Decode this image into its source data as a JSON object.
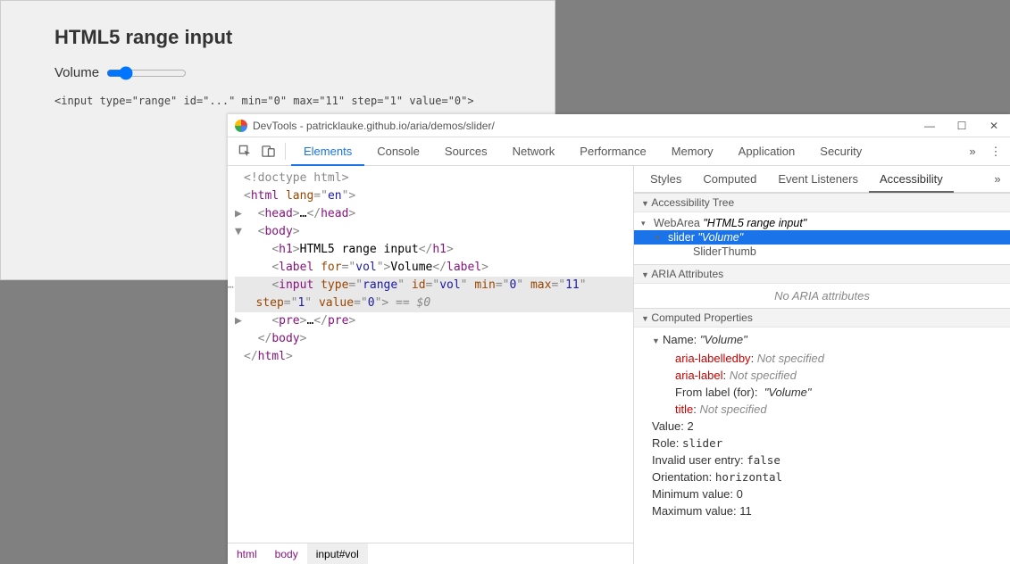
{
  "page": {
    "heading": "HTML5 range input",
    "label": "Volume",
    "code": "<input type=\"range\" id=\"...\" min=\"0\" max=\"11\" step=\"1\" value=\"0\">",
    "sliderMin": "0",
    "sliderMax": "11",
    "sliderValue": "2"
  },
  "devtools": {
    "title": "DevTools - patricklauke.github.io/aria/demos/slider/",
    "mainTabs": [
      "Elements",
      "Console",
      "Sources",
      "Network",
      "Performance",
      "Memory",
      "Application",
      "Security"
    ],
    "mainActive": 0,
    "sideTabs": [
      "Styles",
      "Computed",
      "Event Listeners",
      "Accessibility"
    ],
    "sideActive": 3,
    "breadcrumbs": [
      "html",
      "body",
      "input#vol"
    ],
    "dom": [
      {
        "d": 0,
        "a": "",
        "h": "<span class='t-doctype'>&lt;!doctype html&gt;</span>"
      },
      {
        "d": 0,
        "a": "",
        "h": "<span class='t-punc'>&lt;</span><span class='t-tag'>html</span> <span class='t-attr'>lang</span><span class='t-punc'>=\"</span><span class='t-val'>en</span><span class='t-punc'>\"&gt;</span>"
      },
      {
        "d": 1,
        "a": "▶",
        "h": "<span class='t-punc'>&lt;</span><span class='t-tag'>head</span><span class='t-punc'>&gt;</span><span class='t-text'>…</span><span class='t-punc'>&lt;/</span><span class='t-tag'>head</span><span class='t-punc'>&gt;</span>"
      },
      {
        "d": 1,
        "a": "▼",
        "h": "<span class='t-punc'>&lt;</span><span class='t-tag'>body</span><span class='t-punc'>&gt;</span>"
      },
      {
        "d": 2,
        "a": "",
        "h": "<span class='t-punc'>&lt;</span><span class='t-tag'>h1</span><span class='t-punc'>&gt;</span><span class='t-text'>HTML5 range input</span><span class='t-punc'>&lt;/</span><span class='t-tag'>h1</span><span class='t-punc'>&gt;</span>"
      },
      {
        "d": 2,
        "a": "",
        "h": "<span class='t-punc'>&lt;</span><span class='t-tag'>label</span> <span class='t-attr'>for</span><span class='t-punc'>=\"</span><span class='t-val'>vol</span><span class='t-punc'>\"&gt;</span><span class='t-text'>Volume</span><span class='t-punc'>&lt;/</span><span class='t-tag'>label</span><span class='t-punc'>&gt;</span>"
      },
      {
        "d": 2,
        "a": "",
        "sel": true,
        "h": "<span class='t-punc'>&lt;</span><span class='t-tag'>input</span> <span class='t-attr'>type</span><span class='t-punc'>=\"</span><span class='t-val'>range</span><span class='t-punc'>\"</span> <span class='t-attr'>id</span><span class='t-punc'>=\"</span><span class='t-val'>vol</span><span class='t-punc'>\"</span> <span class='t-attr'>min</span><span class='t-punc'>=\"</span><span class='t-val'>0</span><span class='t-punc'>\"</span> <span class='t-attr'>max</span><span class='t-punc'>=\"</span><span class='t-val'>11</span><span class='t-punc'>\"</span><br>   <span class='t-attr'>step</span><span class='t-punc'>=\"</span><span class='t-val'>1</span><span class='t-punc'>\"</span> <span class='t-attr'>value</span><span class='t-punc'>=\"</span><span class='t-val'>0</span><span class='t-punc'>\"&gt;</span> <span class='t-comment'>== $0</span>"
      },
      {
        "d": 2,
        "a": "▶",
        "h": "<span class='t-punc'>&lt;</span><span class='t-tag'>pre</span><span class='t-punc'>&gt;</span><span class='t-text'>…</span><span class='t-punc'>&lt;/</span><span class='t-tag'>pre</span><span class='t-punc'>&gt;</span>"
      },
      {
        "d": 1,
        "a": "",
        "h": "<span class='t-punc'>&lt;/</span><span class='t-tag'>body</span><span class='t-punc'>&gt;</span>"
      },
      {
        "d": 0,
        "a": "",
        "h": "<span class='t-punc'>&lt;/</span><span class='t-tag'>html</span><span class='t-punc'>&gt;</span>"
      }
    ],
    "a11y": {
      "treeHead": "Accessibility Tree",
      "tree": [
        {
          "d": 0,
          "role": "WebArea",
          "name": "\"HTML5 range input\""
        },
        {
          "d": 1,
          "role": "slider",
          "name": "\"Volume\"",
          "sel": true
        },
        {
          "d": 2,
          "role": "SliderThumb",
          "name": ""
        }
      ],
      "ariaHead": "ARIA Attributes",
      "ariaBody": "No ARIA attributes",
      "cpHead": "Computed Properties",
      "cp": {
        "nameLabel": "Name:",
        "nameVal": "\"Volume\"",
        "labelledby": "aria-labelledby",
        "label": "aria-label",
        "fromLabel": "From label (for):",
        "fromLabelVal": "\"Volume\"",
        "title": "title",
        "ns": "Not specified",
        "props": [
          [
            "Value:",
            "2"
          ],
          [
            "Role:",
            "slider",
            true
          ],
          [
            "Invalid user entry:",
            "false",
            true
          ],
          [
            "Orientation:",
            "horizontal",
            true
          ],
          [
            "Minimum value:",
            "0"
          ],
          [
            "Maximum value:",
            "11"
          ]
        ]
      }
    }
  }
}
